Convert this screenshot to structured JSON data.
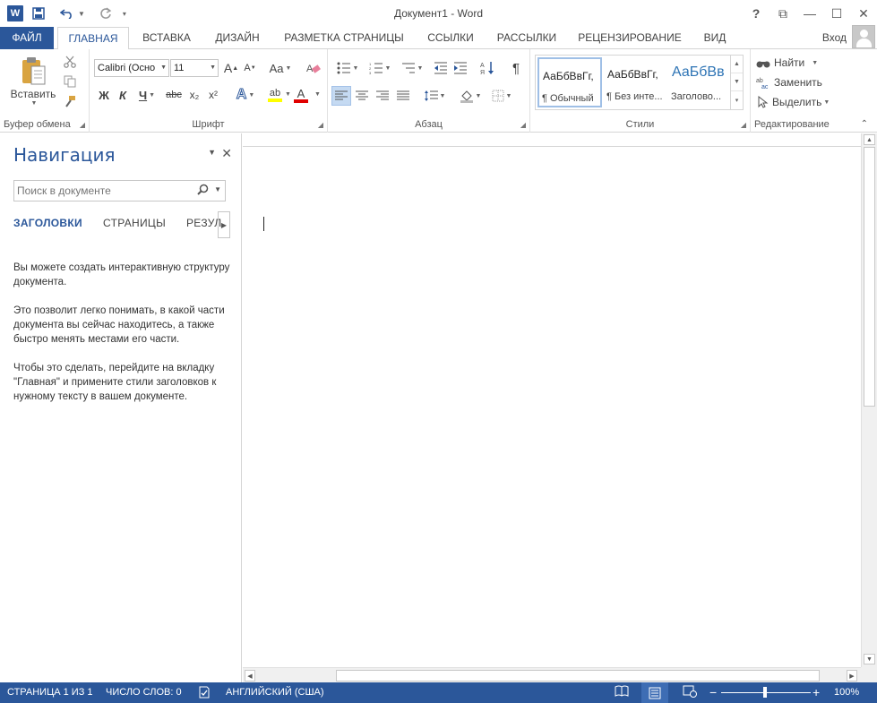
{
  "titlebar": {
    "app_badge": "W",
    "title": "Документ1 - Word",
    "help": "?",
    "restore_ribbon": "⧉",
    "minimize": "—",
    "maximize": "☐",
    "close": "✕"
  },
  "qat": {
    "save": "💾",
    "undo": "↶",
    "redo": "↻",
    "customize": "⌄"
  },
  "tabs": {
    "file": "ФАЙЛ",
    "home": "ГЛАВНАЯ",
    "insert": "ВСТАВКА",
    "design": "ДИЗАЙН",
    "layout": "РАЗМЕТКА СТРАНИЦЫ",
    "references": "ССЫЛКИ",
    "mailings": "РАССЫЛКИ",
    "review": "РЕЦЕНЗИРОВАНИЕ",
    "view": "ВИД",
    "signin": "Вход"
  },
  "ribbon": {
    "clipboard": {
      "label": "Буфер обмена",
      "paste": "Вставить"
    },
    "font": {
      "label": "Шрифт",
      "font_name": "Calibri (Осно",
      "font_size": "11",
      "grow": "A",
      "shrink": "A",
      "change_case": "Aa",
      "bold": "Ж",
      "italic": "К",
      "underline": "Ч",
      "strike": "abc",
      "subscript": "x₂",
      "superscript": "x²",
      "text_effects": "A",
      "highlight": "ab",
      "font_color": "A"
    },
    "paragraph": {
      "label": "Абзац",
      "pilcrow": "¶"
    },
    "styles": {
      "label": "Стили",
      "items": [
        {
          "preview": "АаБбВвГг,",
          "name": "¶ Обычный"
        },
        {
          "preview": "АаБбВвГг,",
          "name": "¶ Без инте..."
        },
        {
          "preview": "АаБбВв",
          "name": "Заголово..."
        }
      ]
    },
    "editing": {
      "label": "Редактирование",
      "find": "Найти",
      "replace": "Заменить",
      "select": "Выделить"
    }
  },
  "navigation": {
    "title": "Навигация",
    "search_placeholder": "Поиск в документе",
    "tabs": [
      "ЗАГОЛОВКИ",
      "СТРАНИЦЫ",
      "РЕЗУЛ"
    ],
    "paragraphs": [
      "Вы можете создать интерактивную структуру документа.",
      "Это позволит легко понимать, в какой части документа вы сейчас находитесь, а также быстро менять местами его части.",
      "Чтобы это сделать, перейдите на вкладку \"Главная\" и примените стили заголовков к нужному тексту в вашем документе."
    ]
  },
  "statusbar": {
    "page": "СТРАНИЦА 1 ИЗ 1",
    "words": "ЧИСЛО СЛОВ: 0",
    "language": "АНГЛИЙСКИЙ (США)",
    "zoom": "100%",
    "zoom_minus": "−",
    "zoom_plus": "+"
  },
  "colors": {
    "accent": "#2b579a",
    "highlight_yellow": "#ffff00",
    "font_red": "#e00000"
  }
}
